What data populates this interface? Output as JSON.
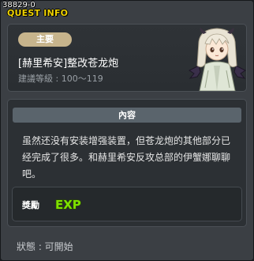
{
  "window": {
    "quest_id": "38829-0",
    "title": "QUEST INFO"
  },
  "header": {
    "badge": "主要",
    "quest_name": "[赫里希安]整改苍龙炮",
    "recommended_level": "建議等級 : 100～119",
    "npc_icon": "npc-portrait-icon"
  },
  "content": {
    "header": "內容",
    "text": "虽然还没有安装增强装置，但苍龙炮的其他部分已经完成了很多。和赫里希安反攻总部的伊蟹娜聊聊吧。"
  },
  "reward": {
    "label": "獎勵",
    "exp_icon": "exp-icon",
    "exp_text": "EXP"
  },
  "status": {
    "text": "狀態 : 可開始"
  },
  "colors": {
    "title": "#f0d400",
    "badge": "#c7b48c",
    "exp": "#7ee000"
  }
}
